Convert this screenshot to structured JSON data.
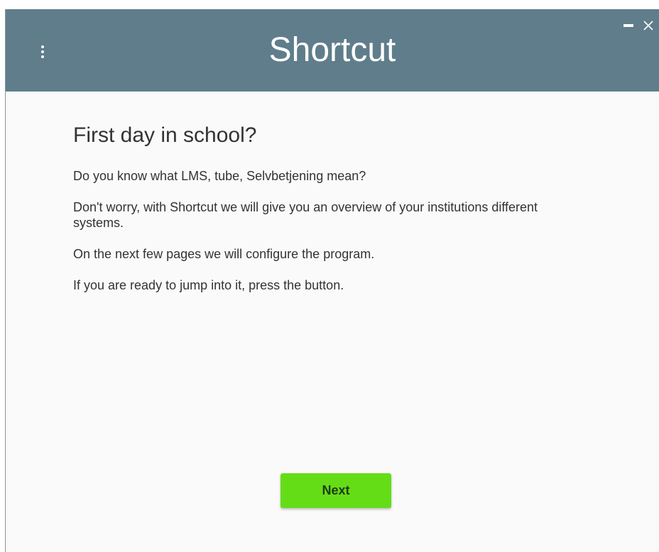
{
  "app": {
    "title": "Shortcut"
  },
  "header": {
    "menu_icon": "more-vert-icon",
    "minimize_icon": "minimize-icon",
    "close_icon": "close-icon"
  },
  "intro": {
    "heading": "First day in school?",
    "paragraphs": [
      "Do you know what LMS, tube, Selvbetjening mean?",
      "Don't worry, with Shortcut we will give you an overview of your institutions different systems.",
      "On the next few pages we will configure the program.",
      "If you are ready to jump into it, press the button."
    ]
  },
  "actions": {
    "next_label": "Next"
  },
  "colors": {
    "header": "#607d8b",
    "background": "#fafafa",
    "button": "#64dd17",
    "text": "#333333"
  }
}
